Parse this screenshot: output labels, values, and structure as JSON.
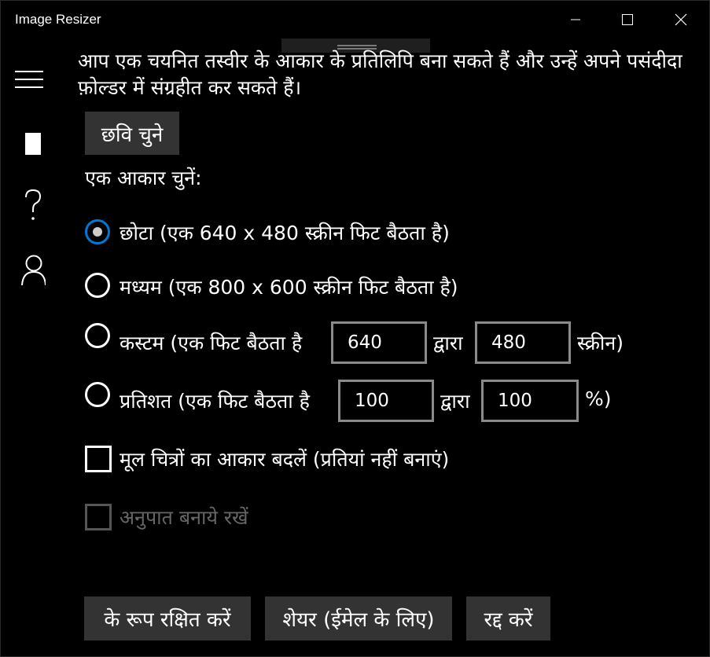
{
  "window": {
    "title": "Image Resizer"
  },
  "description": "आप एक चयनित तस्वीर के आकार के प्रतिलिपि बना सकते हैं और उन्हें अपने पसंदीदा फ़ोल्डर में संग्रहीत कर सकते हैं।",
  "select_image_button": "छवि चुने",
  "size_prompt": "एक आकार चुनें:",
  "options": {
    "small": "छोटा (एक 640 x 480 स्क्रीन फिट बैठता है)",
    "medium": "मध्यम (एक 800 x 600 स्क्रीन फिट बैठता है)",
    "custom_prefix": "कस्टम (एक फिट बैठता है",
    "custom_width": "640",
    "custom_by": "द्वारा",
    "custom_height": "480",
    "custom_suffix": "स्क्रीन)",
    "percent_prefix": "प्रतिशत (एक फिट बैठता है",
    "percent_width": "100",
    "percent_by": "द्वारा",
    "percent_height": "100",
    "percent_suffix": "%)",
    "selected": "small"
  },
  "checkboxes": {
    "resize_originals": "मूल चित्रों का आकार बदलें (प्रतियां नहीं बनाएं)",
    "keep_ratio": "अनुपात बनाये रखें"
  },
  "actions": {
    "save_as": "के रूप रक्षित करें",
    "share": "शेयर (ईमेल के लिए)",
    "cancel": "रद्द करें"
  },
  "colors": {
    "accent": "#0078d7",
    "button_bg": "#333333"
  }
}
